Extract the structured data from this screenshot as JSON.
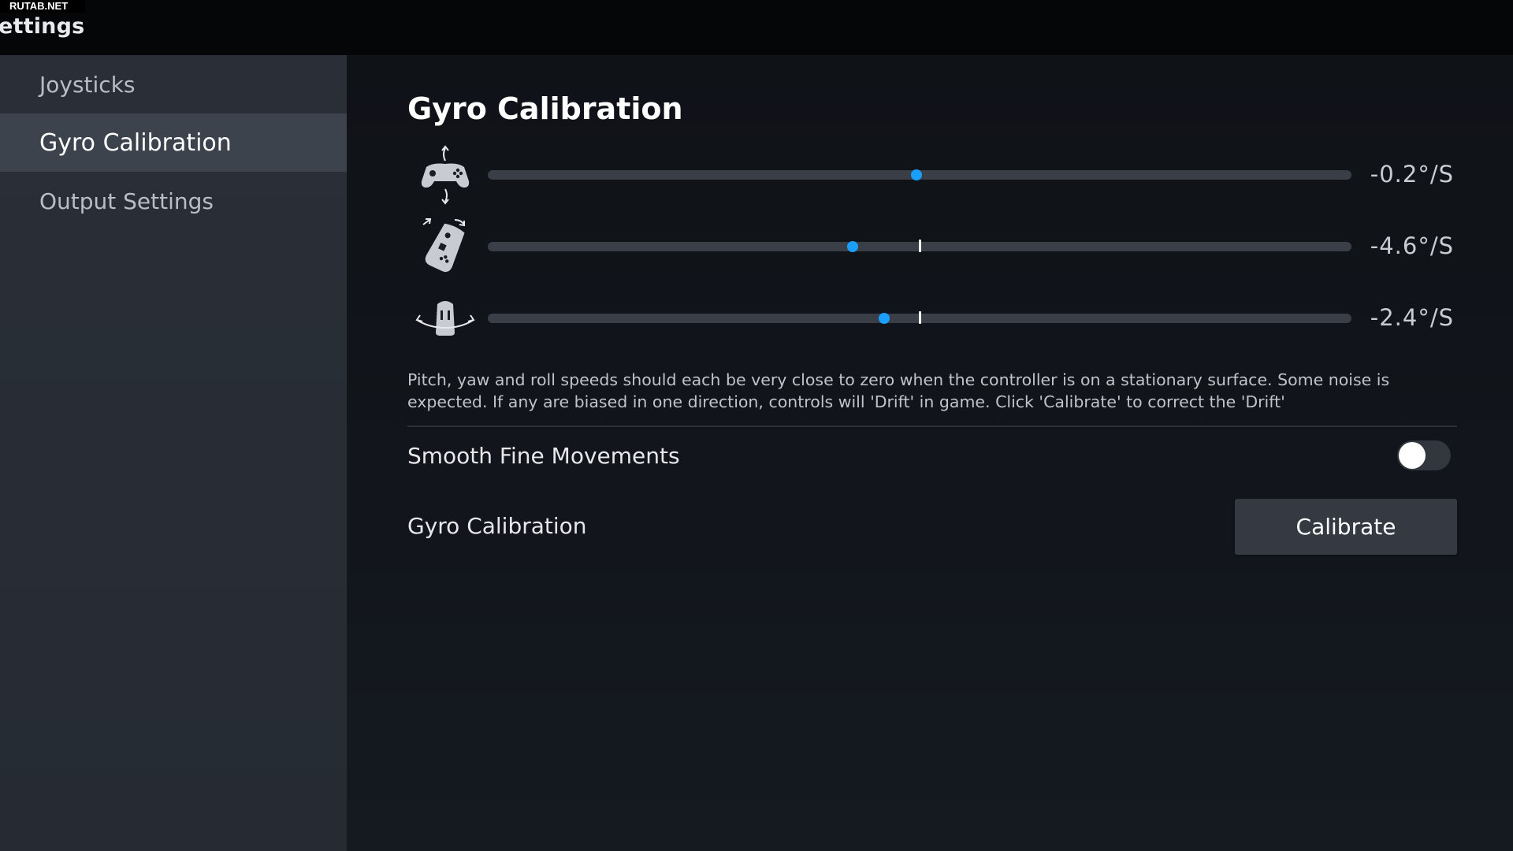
{
  "watermark": "RUTAB.NET",
  "window": {
    "title": "ettings"
  },
  "sidebar": {
    "items": [
      {
        "label": "Joysticks",
        "active": false
      },
      {
        "label": "Gyro Calibration",
        "active": true
      },
      {
        "label": "Output Settings",
        "active": false
      }
    ]
  },
  "main": {
    "title": "Gyro Calibration",
    "axes": [
      {
        "icon": "pitch-controller-icon",
        "value": -0.2,
        "readout": "-0.2°/S"
      },
      {
        "icon": "roll-controller-icon",
        "value": -4.6,
        "readout": "-4.6°/S"
      },
      {
        "icon": "yaw-controller-icon",
        "value": -2.4,
        "readout": "-2.4°/S"
      }
    ],
    "description": "Pitch, yaw and roll speeds should each be very close to zero when the controller is on a stationary surface. Some noise is expected. If any are biased in one direction, controls will 'Drift' in game. Click 'Calibrate' to correct the 'Drift'",
    "smooth": {
      "label": "Smooth Fine Movements",
      "enabled": false
    },
    "calibration": {
      "label": "Gyro Calibration",
      "button_label": "Calibrate"
    }
  },
  "colors": {
    "accent": "#1a9fff",
    "sidebar_active": "#3d434c",
    "track": "#3a3f47"
  }
}
